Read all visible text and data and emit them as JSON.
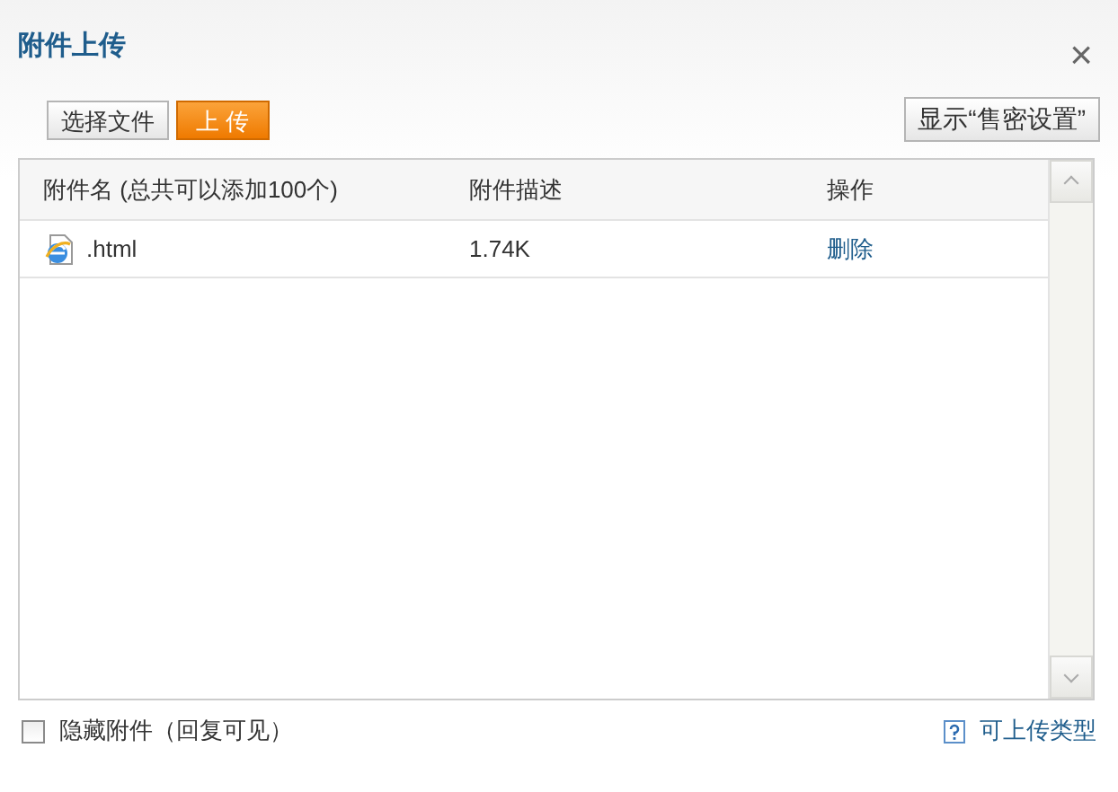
{
  "window": {
    "title": "附件上传",
    "close": "×"
  },
  "toolbar": {
    "buttons": [
      {
        "label": "选择文件",
        "kind": "plain"
      },
      {
        "label": "上 传",
        "kind": "primary"
      }
    ],
    "right_button": "显示“售密设置”"
  },
  "table": {
    "columns": [
      "附件名 (总共可以添加100个)",
      "附件描述",
      "操作"
    ],
    "rows": [
      {
        "name": ".html",
        "size": "1.74K",
        "action": "删除"
      }
    ]
  },
  "footer": {
    "checkbox": {
      "label": "隐藏附件（回复可见）",
      "checked": false
    },
    "link": "可上传类型"
  }
}
